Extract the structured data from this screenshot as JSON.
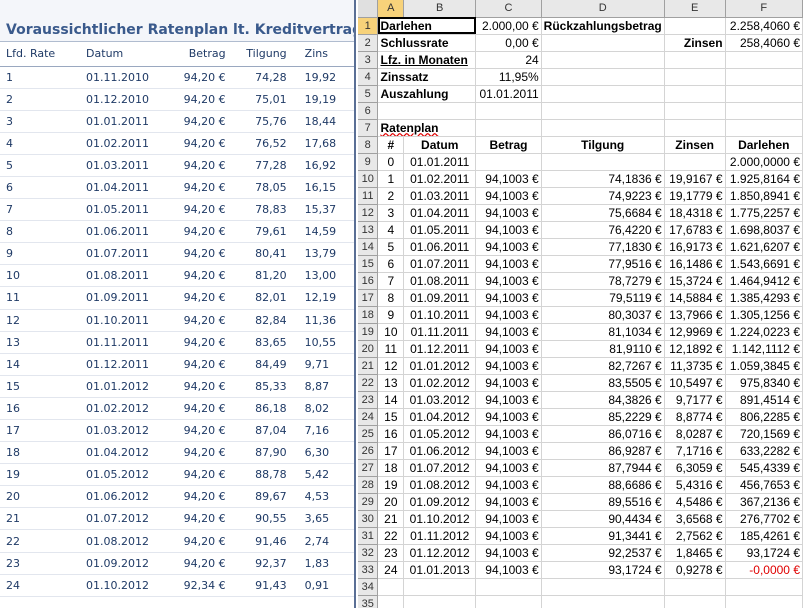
{
  "left_panel": {
    "title": "Voraussichtlicher Ratenplan lt. Kreditvertrag***",
    "headers": [
      "Lfd. Rate",
      "Datum",
      "Betrag",
      "Tilgung",
      "Zins"
    ],
    "rows": [
      [
        "1",
        "01.11.2010",
        "94,20 €",
        "74,28",
        "19,92"
      ],
      [
        "2",
        "01.12.2010",
        "94,20 €",
        "75,01",
        "19,19"
      ],
      [
        "3",
        "01.01.2011",
        "94,20 €",
        "75,76",
        "18,44"
      ],
      [
        "4",
        "01.02.2011",
        "94,20 €",
        "76,52",
        "17,68"
      ],
      [
        "5",
        "01.03.2011",
        "94,20 €",
        "77,28",
        "16,92"
      ],
      [
        "6",
        "01.04.2011",
        "94,20 €",
        "78,05",
        "16,15"
      ],
      [
        "7",
        "01.05.2011",
        "94,20 €",
        "78,83",
        "15,37"
      ],
      [
        "8",
        "01.06.2011",
        "94,20 €",
        "79,61",
        "14,59"
      ],
      [
        "9",
        "01.07.2011",
        "94,20 €",
        "80,41",
        "13,79"
      ],
      [
        "10",
        "01.08.2011",
        "94,20 €",
        "81,20",
        "13,00"
      ],
      [
        "11",
        "01.09.2011",
        "94,20 €",
        "82,01",
        "12,19"
      ],
      [
        "12",
        "01.10.2011",
        "94,20 €",
        "82,84",
        "11,36"
      ],
      [
        "13",
        "01.11.2011",
        "94,20 €",
        "83,65",
        "10,55"
      ],
      [
        "14",
        "01.12.2011",
        "94,20 €",
        "84,49",
        "9,71"
      ],
      [
        "15",
        "01.01.2012",
        "94,20 €",
        "85,33",
        "8,87"
      ],
      [
        "16",
        "01.02.2012",
        "94,20 €",
        "86,18",
        "8,02"
      ],
      [
        "17",
        "01.03.2012",
        "94,20 €",
        "87,04",
        "7,16"
      ],
      [
        "18",
        "01.04.2012",
        "94,20 €",
        "87,90",
        "6,30"
      ],
      [
        "19",
        "01.05.2012",
        "94,20 €",
        "88,78",
        "5,42"
      ],
      [
        "20",
        "01.06.2012",
        "94,20 €",
        "89,67",
        "4,53"
      ],
      [
        "21",
        "01.07.2012",
        "94,20 €",
        "90,55",
        "3,65"
      ],
      [
        "22",
        "01.08.2012",
        "94,20 €",
        "91,46",
        "2,74"
      ],
      [
        "23",
        "01.09.2012",
        "94,20 €",
        "92,37",
        "1,83"
      ],
      [
        "24",
        "01.10.2012",
        "92,34 €",
        "91,43",
        "0,91"
      ]
    ]
  },
  "sheet": {
    "columns": [
      "A",
      "B",
      "C",
      "D",
      "E",
      "F"
    ],
    "selected_column": "A",
    "selected_row": "1",
    "top": [
      {
        "row": "1",
        "a": "Darlehen",
        "c": "2.000,00 €",
        "d": "Rückzahlungsbetrag",
        "f": "2.258,4060 €"
      },
      {
        "row": "2",
        "a": "Schlussrate",
        "c": "0,00 €",
        "d": "",
        "e": "Zinsen",
        "f": "258,4060 €"
      },
      {
        "row": "3",
        "a": "Lfz. in Monaten",
        "c": "24"
      },
      {
        "row": "4",
        "a": "Zinssatz",
        "c": "11,95%"
      },
      {
        "row": "5",
        "a": "Auszahlung",
        "c": "01.01.2011"
      },
      {
        "row": "6"
      },
      {
        "row": "7",
        "a": "Ratenplan"
      }
    ],
    "plan_header": {
      "row": "8",
      "a": "#",
      "b": "Datum",
      "c": "Betrag",
      "d": "Tilgung",
      "e": "Zinsen",
      "f": "Darlehen"
    },
    "plan_rows": [
      {
        "row": "9",
        "a": "0",
        "b": "01.01.2011",
        "c": "",
        "d": "",
        "e": "",
        "f": "2.000,0000 €"
      },
      {
        "row": "10",
        "a": "1",
        "b": "01.02.2011",
        "c": "94,1003 €",
        "d": "74,1836 €",
        "e": "19,9167 €",
        "f": "1.925,8164 €"
      },
      {
        "row": "11",
        "a": "2",
        "b": "01.03.2011",
        "c": "94,1003 €",
        "d": "74,9223 €",
        "e": "19,1779 €",
        "f": "1.850,8941 €"
      },
      {
        "row": "12",
        "a": "3",
        "b": "01.04.2011",
        "c": "94,1003 €",
        "d": "75,6684 €",
        "e": "18,4318 €",
        "f": "1.775,2257 €"
      },
      {
        "row": "13",
        "a": "4",
        "b": "01.05.2011",
        "c": "94,1003 €",
        "d": "76,4220 €",
        "e": "17,6783 €",
        "f": "1.698,8037 €"
      },
      {
        "row": "14",
        "a": "5",
        "b": "01.06.2011",
        "c": "94,1003 €",
        "d": "77,1830 €",
        "e": "16,9173 €",
        "f": "1.621,6207 €"
      },
      {
        "row": "15",
        "a": "6",
        "b": "01.07.2011",
        "c": "94,1003 €",
        "d": "77,9516 €",
        "e": "16,1486 €",
        "f": "1.543,6691 €"
      },
      {
        "row": "16",
        "a": "7",
        "b": "01.08.2011",
        "c": "94,1003 €",
        "d": "78,7279 €",
        "e": "15,3724 €",
        "f": "1.464,9412 €"
      },
      {
        "row": "17",
        "a": "8",
        "b": "01.09.2011",
        "c": "94,1003 €",
        "d": "79,5119 €",
        "e": "14,5884 €",
        "f": "1.385,4293 €"
      },
      {
        "row": "18",
        "a": "9",
        "b": "01.10.2011",
        "c": "94,1003 €",
        "d": "80,3037 €",
        "e": "13,7966 €",
        "f": "1.305,1256 €"
      },
      {
        "row": "19",
        "a": "10",
        "b": "01.11.2011",
        "c": "94,1003 €",
        "d": "81,1034 €",
        "e": "12,9969 €",
        "f": "1.224,0223 €"
      },
      {
        "row": "20",
        "a": "11",
        "b": "01.12.2011",
        "c": "94,1003 €",
        "d": "81,9110 €",
        "e": "12,1892 €",
        "f": "1.142,1112 €"
      },
      {
        "row": "21",
        "a": "12",
        "b": "01.01.2012",
        "c": "94,1003 €",
        "d": "82,7267 €",
        "e": "11,3735 €",
        "f": "1.059,3845 €"
      },
      {
        "row": "22",
        "a": "13",
        "b": "01.02.2012",
        "c": "94,1003 €",
        "d": "83,5505 €",
        "e": "10,5497 €",
        "f": "975,8340 €"
      },
      {
        "row": "23",
        "a": "14",
        "b": "01.03.2012",
        "c": "94,1003 €",
        "d": "84,3826 €",
        "e": "9,7177 €",
        "f": "891,4514 €"
      },
      {
        "row": "24",
        "a": "15",
        "b": "01.04.2012",
        "c": "94,1003 €",
        "d": "85,2229 €",
        "e": "8,8774 €",
        "f": "806,2285 €"
      },
      {
        "row": "25",
        "a": "16",
        "b": "01.05.2012",
        "c": "94,1003 €",
        "d": "86,0716 €",
        "e": "8,0287 €",
        "f": "720,1569 €"
      },
      {
        "row": "26",
        "a": "17",
        "b": "01.06.2012",
        "c": "94,1003 €",
        "d": "86,9287 €",
        "e": "7,1716 €",
        "f": "633,2282 €"
      },
      {
        "row": "27",
        "a": "18",
        "b": "01.07.2012",
        "c": "94,1003 €",
        "d": "87,7944 €",
        "e": "6,3059 €",
        "f": "545,4339 €"
      },
      {
        "row": "28",
        "a": "19",
        "b": "01.08.2012",
        "c": "94,1003 €",
        "d": "88,6686 €",
        "e": "5,4316 €",
        "f": "456,7653 €"
      },
      {
        "row": "29",
        "a": "20",
        "b": "01.09.2012",
        "c": "94,1003 €",
        "d": "89,5516 €",
        "e": "4,5486 €",
        "f": "367,2136 €"
      },
      {
        "row": "30",
        "a": "21",
        "b": "01.10.2012",
        "c": "94,1003 €",
        "d": "90,4434 €",
        "e": "3,6568 €",
        "f": "276,7702 €"
      },
      {
        "row": "31",
        "a": "22",
        "b": "01.11.2012",
        "c": "94,1003 €",
        "d": "91,3441 €",
        "e": "2,7562 €",
        "f": "185,4261 €"
      },
      {
        "row": "32",
        "a": "23",
        "b": "01.12.2012",
        "c": "94,1003 €",
        "d": "92,2537 €",
        "e": "1,8465 €",
        "f": "93,1724 €"
      },
      {
        "row": "33",
        "a": "24",
        "b": "01.01.2013",
        "c": "94,1003 €",
        "d": "93,1724 €",
        "e": "0,9278 €",
        "f": "-0,0000 €",
        "negative": true
      }
    ],
    "empty_rows": [
      "34",
      "35"
    ]
  }
}
